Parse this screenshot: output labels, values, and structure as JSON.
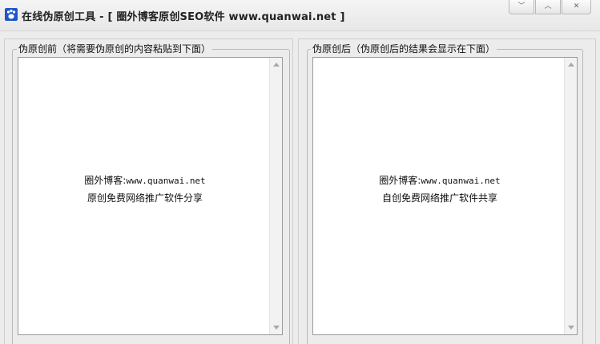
{
  "window": {
    "title": "在线伪原创工具 - [ 圈外博客原创SEO软件 www.quanwai.net ]",
    "controls": {
      "minimize": "﹀",
      "maximize": "︿",
      "close": "✕"
    }
  },
  "left_panel": {
    "legend": "伪原创前（将需要伪原创的内容粘贴到下面）",
    "line1_cn": "圈外博客:",
    "line1_url": "www.quanwai.net",
    "line2": "原创免费网络推广软件分享"
  },
  "right_panel": {
    "legend": "伪原创后（伪原创后的结果会显示在下面）",
    "line1_cn": "圈外博客:",
    "line1_url": "www.quanwai.net",
    "line2": "自创免费网络推广软件共享"
  },
  "colors": {
    "accent": "#1f57c9",
    "background": "#ececec",
    "textarea_bg": "#ffffff"
  }
}
